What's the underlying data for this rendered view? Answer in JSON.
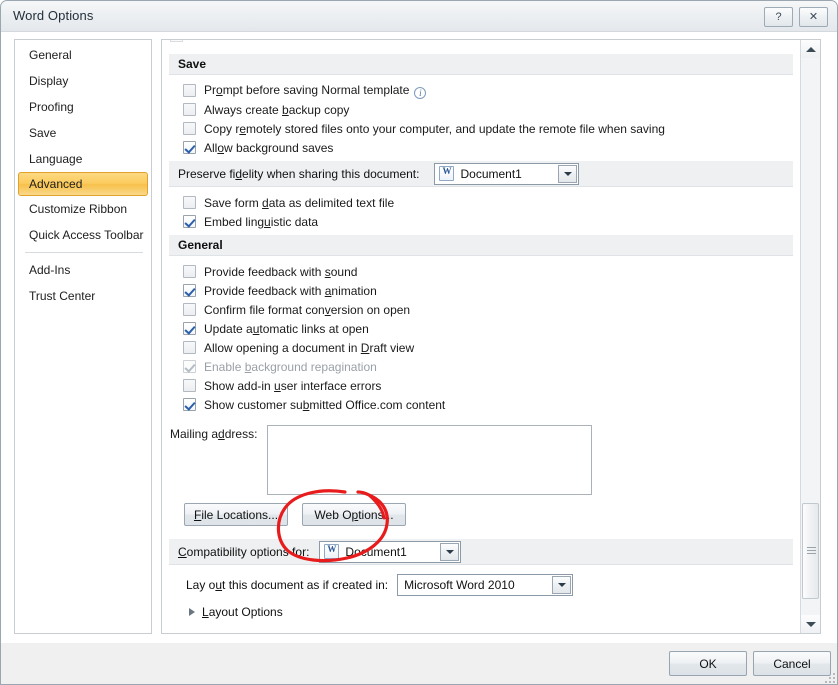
{
  "window": {
    "title": "Word Options",
    "help_button": "?",
    "close_button": "✕"
  },
  "sidebar": {
    "items": [
      {
        "label": "General",
        "selected": false
      },
      {
        "label": "Display",
        "selected": false
      },
      {
        "label": "Proofing",
        "selected": false
      },
      {
        "label": "Save",
        "selected": false
      },
      {
        "label": "Language",
        "selected": false
      },
      {
        "label": "Advanced",
        "selected": true
      },
      {
        "label": "Customize Ribbon",
        "selected": false
      },
      {
        "label": "Quick Access Toolbar",
        "selected": false
      },
      {
        "label": "Add-Ins",
        "selected": false
      },
      {
        "label": "Trust Center",
        "selected": false
      }
    ],
    "selected_color": "#f7c04a",
    "selected_border_color": "#e0a22c"
  },
  "save_section": {
    "header": "Save",
    "options": [
      {
        "label_pre": "Pr",
        "accel": "o",
        "label_post": "mpt before saving Normal template",
        "checked": false,
        "disabled": false,
        "info": true
      },
      {
        "label_pre": "Always create ",
        "accel": "b",
        "label_post": "ackup copy",
        "checked": false,
        "disabled": false,
        "info": false
      },
      {
        "label_pre": "Copy r",
        "accel": "e",
        "label_post": "motely stored files onto your computer, and update the remote file when saving",
        "checked": false,
        "disabled": false,
        "info": false
      },
      {
        "label_pre": "All",
        "accel": "o",
        "label_post": "w background saves",
        "checked": true,
        "disabled": false,
        "info": false
      }
    ]
  },
  "preserve_fidelity": {
    "label_pre": "Preserve fi",
    "accel": "d",
    "label_post": "elity when sharing this document:",
    "dropdown_value": "Document1",
    "dropdown_icon": "word-document-icon",
    "options": [
      {
        "label_pre": "Save form ",
        "accel": "d",
        "label_post": "ata as delimited text file",
        "checked": false,
        "disabled": false
      },
      {
        "label_pre": "Embed ling",
        "accel": "u",
        "label_post": "istic data",
        "checked": true,
        "disabled": false
      }
    ]
  },
  "general_section": {
    "header": "General",
    "options": [
      {
        "label_pre": "Provide feedback with ",
        "accel": "s",
        "label_post": "ound",
        "checked": false,
        "disabled": false
      },
      {
        "label_pre": "Provide feedback with ",
        "accel": "a",
        "label_post": "nimation",
        "checked": true,
        "disabled": false
      },
      {
        "label_pre": "Confirm file format con",
        "accel": "v",
        "label_post": "ersion on open",
        "checked": false,
        "disabled": false
      },
      {
        "label_pre": "Update a",
        "accel": "u",
        "label_post": "tomatic links at open",
        "checked": true,
        "disabled": false
      },
      {
        "label_pre": "Allow opening a document in ",
        "accel": "D",
        "label_post": "raft view",
        "checked": false,
        "disabled": false
      },
      {
        "label_pre": "Enable ",
        "accel": "b",
        "label_post": "ackground repagination",
        "checked": true,
        "disabled": true
      },
      {
        "label_pre": "Show add-in ",
        "accel": "u",
        "label_post": "ser interface errors",
        "checked": false,
        "disabled": false
      },
      {
        "label_pre": "Show customer su",
        "accel": "b",
        "label_post": "mitted Office.com content",
        "checked": true,
        "disabled": false
      }
    ],
    "mailing_address": {
      "label_pre": "Mailing a",
      "accel": "d",
      "label_post": "dress:",
      "value": ""
    },
    "buttons": [
      {
        "label_pre": "",
        "accel": "F",
        "label_post": "ile Locations..."
      },
      {
        "label_pre": "Web O",
        "accel": "p",
        "label_post": "tions..."
      }
    ]
  },
  "compatibility": {
    "label_pre": "",
    "accel": "C",
    "label_post": "ompatibility options for:",
    "dropdown_value": "Document1",
    "dropdown_icon": "word-document-icon",
    "layout_label_pre": "Lay o",
    "layout_accel": "u",
    "layout_label_post": "t this document as if created in:",
    "layout_dropdown_value": "Microsoft Word 2010",
    "expander_pre": "",
    "expander_accel": "L",
    "expander_post": "ayout Options"
  },
  "footer": {
    "ok_label": "OK",
    "cancel_label": "Cancel"
  },
  "annotation": {
    "shape": "hand-drawn-red-ellipse",
    "color": "#e81c1c",
    "target": "Web Options..."
  }
}
